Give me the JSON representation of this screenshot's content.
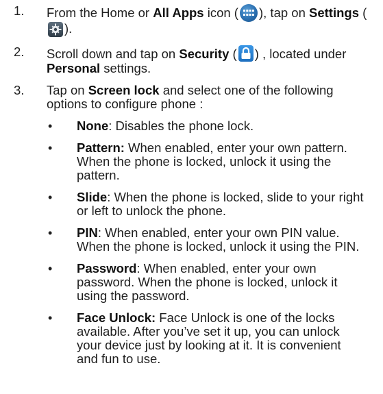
{
  "steps": [
    {
      "number": "1.",
      "t1": "From the Home or ",
      "b1": "All Apps",
      "t2": " icon (",
      "t3": "), tap on ",
      "b2": "Settings",
      "t4": " (",
      "t5": ")."
    },
    {
      "number": "2.",
      "t1": "Scroll down and tap on ",
      "b1": "Security",
      "t2": " (",
      "t3": ") , located under ",
      "b2": "Personal",
      "t4": " settings."
    },
    {
      "number": "3.",
      "t1": "Tap on ",
      "b1": "Screen lock",
      "t2": " and select one of the following options to configure phone :"
    }
  ],
  "bullet_symbol": "•",
  "options": [
    {
      "name": "None",
      "sep": ":",
      "desc": " Disables the phone lock."
    },
    {
      "name": "Pattern:",
      "sep": "",
      "desc": " When enabled, enter your own pattern. When the phone is locked, unlock it using the pattern."
    },
    {
      "name": "Slide",
      "sep": ":",
      "desc": " When the phone is locked, slide to your right or left to unlock the phone."
    },
    {
      "name": "PIN",
      "sep": ":",
      "desc": " When enabled, enter your own PIN value. When the phone is locked, unlock it using the PIN."
    },
    {
      "name": "Password",
      "sep": ":",
      "desc": " When enabled, enter your own password. When the phone is locked, unlock it using the password."
    },
    {
      "name": "Face Unlock:",
      "sep": "",
      "desc": " Face Unlock is one of the locks available. After you’ve set it up, you can unlock your device just by looking at it. It is convenient and fun to use."
    }
  ],
  "icons": {
    "apps": "all-apps-icon",
    "settings": "settings-icon",
    "security": "security-lock-icon"
  },
  "colors": {
    "text": "#1f1f1f",
    "apps_icon": "#2a6fb0",
    "settings_icon": "#3a4853",
    "security_icon": "#2a82d6"
  }
}
